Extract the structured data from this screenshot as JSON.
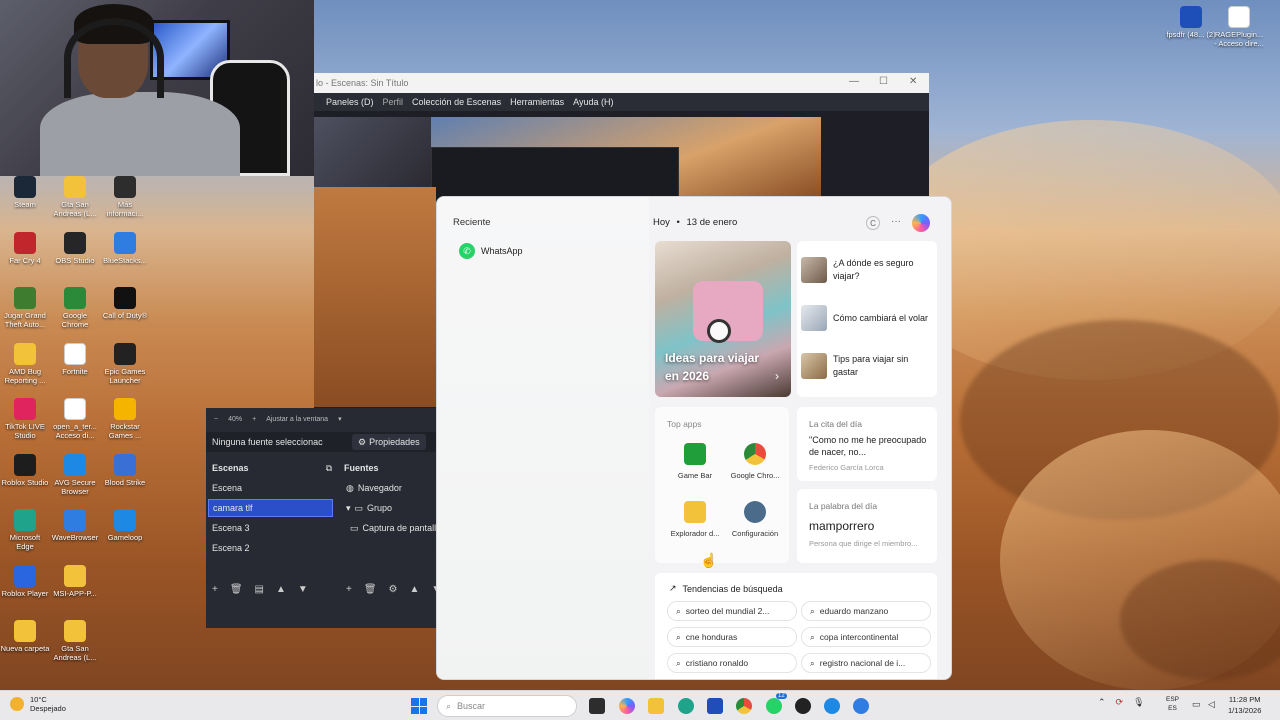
{
  "obs": {
    "title": "lo - Escenas: Sin Título",
    "menu": [
      "Paneles (D)",
      "Perfil",
      "Colección de Escenas",
      "Herramientas",
      "Ayuda (H)"
    ],
    "zoom": "40%",
    "fit": "Ajustar a la ventana",
    "no_source": "Ninguna fuente seleccionac",
    "properties": "Propiedades",
    "scenes_header": "Escenas",
    "sources_header": "Fuentes",
    "scenes": [
      "Escena",
      "camara tlf",
      "Escena 3",
      "Escena 2"
    ],
    "sources": [
      "Navegador",
      "Grupo",
      "Captura de pantall"
    ]
  },
  "desktop_icons": [
    {
      "label": "Steam",
      "color": "#1b2838"
    },
    {
      "label": "Gta San Andreas (L...",
      "color": "#f2c23a"
    },
    {
      "label": "Más informaci...",
      "color": "#2d2d2d"
    },
    {
      "label": "Far Cry 4",
      "color": "#c0262c"
    },
    {
      "label": "OBS Studio",
      "color": "#262626"
    },
    {
      "label": "BlueStacks...",
      "color": "#2f7de1"
    },
    {
      "label": "Jugar Grand Theft Auto...",
      "color": "#3e7d2f"
    },
    {
      "label": "Google Chrome",
      "color": "#2a8a3a"
    },
    {
      "label": "Call of Duty®",
      "color": "#111111"
    },
    {
      "label": "AMD Bug Reporting ...",
      "color": "#f2c23a"
    },
    {
      "label": "Fortnite",
      "color": "#ffffff"
    },
    {
      "label": "Epic Games Launcher",
      "color": "#222222"
    },
    {
      "label": "TikTok LIVE Studio",
      "color": "#e0245e"
    },
    {
      "label": "open_a_ter... Acceso di...",
      "color": "#ffffff"
    },
    {
      "label": "Rockstar Games ...",
      "color": "#f5b400"
    },
    {
      "label": "Roblox Studio",
      "color": "#1d1d1d"
    },
    {
      "label": "AVG Secure Browser",
      "color": "#1e88e5"
    },
    {
      "label": "Blood Strike",
      "color": "#3a6fd6"
    },
    {
      "label": "Microsoft Edge",
      "color": "#1fa38a"
    },
    {
      "label": "WaveBrowser",
      "color": "#2f7de1"
    },
    {
      "label": "Gameloop",
      "color": "#1e88e5"
    },
    {
      "label": "Roblox Player",
      "color": "#2a66e0"
    },
    {
      "label": "MSI-APP-P...",
      "color": "#f2c23a"
    },
    {
      "label": "Nueva carpeta",
      "color": "#f2c23a"
    },
    {
      "label": "Gta San Andreas (L...",
      "color": "#f2c23a"
    }
  ],
  "top_right_icons": [
    {
      "label": "fpsdfr (48... (2)",
      "color": "#1e4fb8"
    },
    {
      "label": "RAGEPlugin... - Acceso dire...",
      "color": "#ffffff"
    }
  ],
  "start": {
    "recent_label": "Reciente",
    "recent_items": [
      "WhatsApp"
    ],
    "today": "Hoy",
    "date": "13 de enero",
    "user_initial": "C",
    "more": "···",
    "hero_title": "Ideas para viajar en 2026",
    "news": [
      {
        "title": "¿A dónde es seguro viajar?"
      },
      {
        "title": "Cómo cambiará el volar"
      },
      {
        "title": "Tips para viajar sin gastar"
      }
    ],
    "top_apps_label": "Top apps",
    "top_apps": [
      {
        "label": "Game Bar",
        "color": "#1f9e3a"
      },
      {
        "label": "Google Chro...",
        "color": "#e74c3c"
      },
      {
        "label": "Explorador d...",
        "color": "#f2c23a"
      },
      {
        "label": "Configuración",
        "color": "#4a6b8a"
      }
    ],
    "quote_label": "La cita del día",
    "quote": "\"Como no me he preocupado de nacer, no...",
    "quote_author": "Federico García Lorca",
    "word_label": "La palabra del día",
    "word": "mamporrero",
    "word_def": "Persona que dirige el miembro...",
    "trends_label": "Tendencias de búsqueda",
    "trends": [
      "sorteo del mundial 2...",
      "eduardo manzano",
      "cne honduras",
      "copa intercontinental",
      "cristiano ronaldo",
      "registro nacional de i..."
    ]
  },
  "taskbar": {
    "temperature": "10°C",
    "weather": "Despejado",
    "search_placeholder": "Buscar",
    "lang_top": "ESP",
    "lang_bottom": "ES",
    "time": "11:28 PM",
    "date": "1/13/2026",
    "whatsapp_badge": "12"
  }
}
